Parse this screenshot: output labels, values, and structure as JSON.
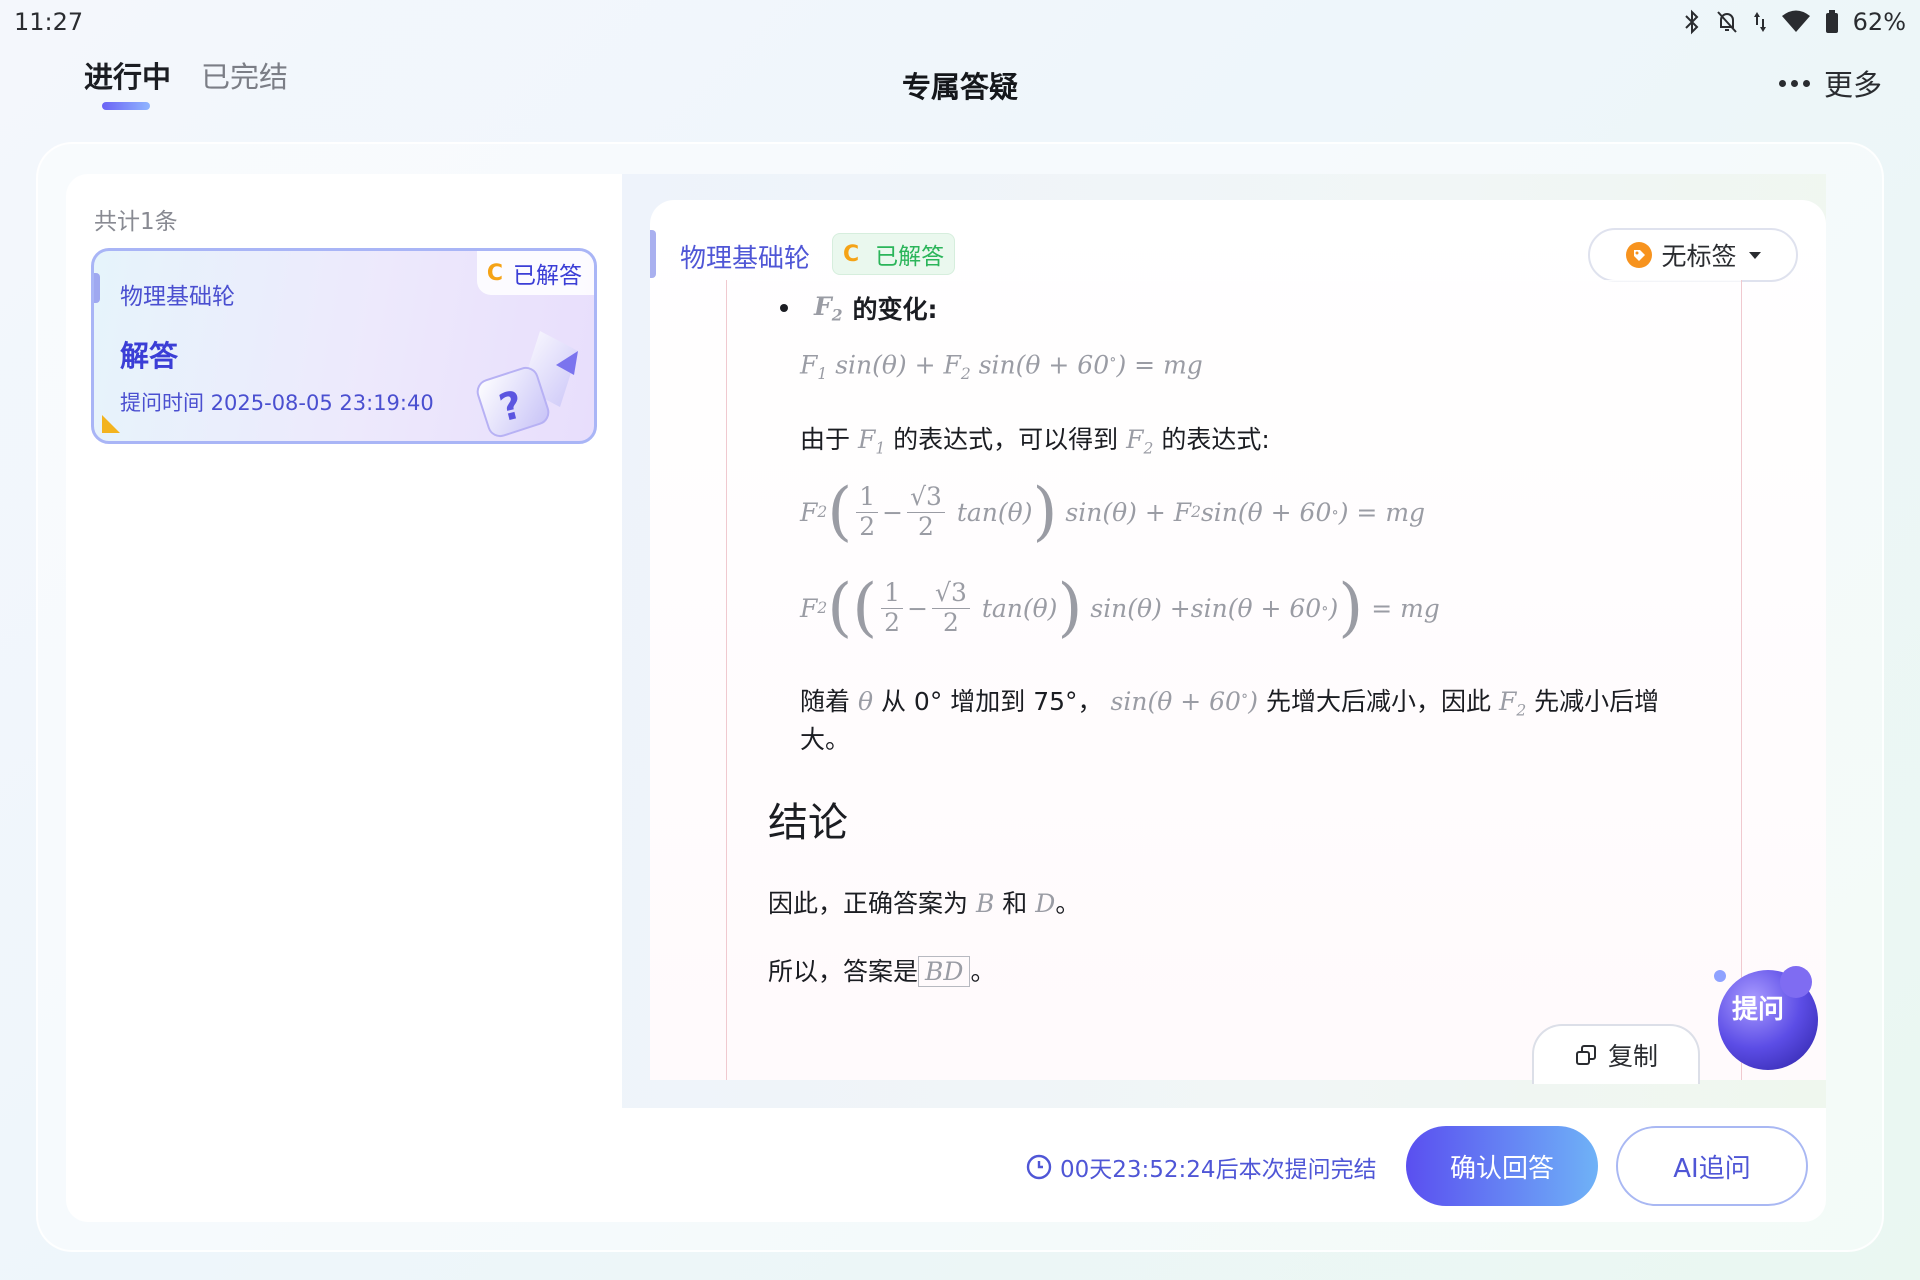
{
  "status": {
    "time": "11:27",
    "battery": "62%"
  },
  "header": {
    "tabs": [
      "进行中",
      "已完结"
    ],
    "active_tab": "进行中",
    "title": "专属答疑",
    "more_label": "更多"
  },
  "list": {
    "count_label": "共计1条",
    "items": [
      {
        "subject": "物理基础轮",
        "grade_badge": "C",
        "status": "已解答",
        "title": "解答",
        "time_label": "提问时间 2025-08-05 23:19:40"
      }
    ]
  },
  "answer": {
    "subject": "物理基础轮",
    "grade_badge": "C",
    "status": "已解答",
    "tag_label": "无标签",
    "bullet_heading_suffix": "的变化:",
    "eq1": "F₁ sin(θ) + F₂ sin(θ + 60°) = mg",
    "para1_a": "由于",
    "para1_b": "的表达式，可以得到",
    "para1_c": "的表达式:",
    "para2_a": "随着",
    "para2_b": "从 0° 增加到 75°，",
    "para2_c": "先增大后减小，因此",
    "para2_d": "先减小后增",
    "para2_e": "大。",
    "conclusion_heading": "结论",
    "conclusion_a": "因此，正确答案为",
    "conclusion_b": "和",
    "conclusion_c": "。",
    "final_a": "所以，答案是",
    "final_answer": "BD",
    "final_b": "。",
    "copy_label": "复制",
    "ask_label": "提问"
  },
  "footer": {
    "countdown": "00天23:52:24后本次提问完结",
    "confirm_label": "确认回答",
    "ai_label": "AI追问"
  },
  "colors": {
    "accent": "#4f56d6",
    "success": "#2bb55a",
    "grade": "#f5a316"
  }
}
